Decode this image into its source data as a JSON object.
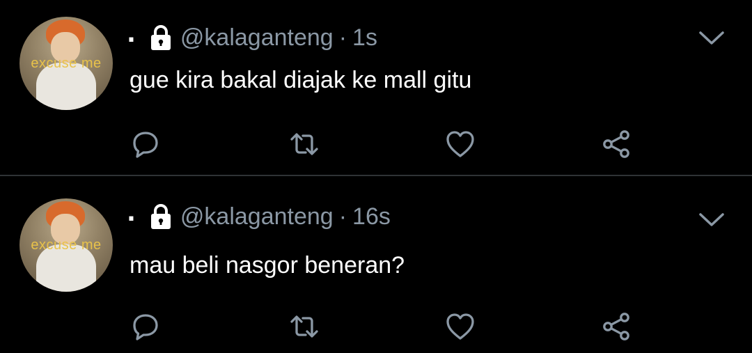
{
  "tweets": [
    {
      "name_label": ".",
      "handle": "@kalaganteng",
      "separator": "·",
      "time": "1s",
      "text": "gue kira bakal diajak ke mall gitu",
      "avatar_caption": "excuse me"
    },
    {
      "name_label": ".",
      "handle": "@kalaganteng",
      "separator": "·",
      "time": "16s",
      "text": "mau beli nasgor beneran?",
      "avatar_caption": "excuse me"
    }
  ],
  "icons": {
    "lock": "lock-icon",
    "chevron": "chevron-down-icon",
    "reply": "reply-icon",
    "retweet": "retweet-icon",
    "like": "heart-icon",
    "share": "share-icon"
  },
  "colors": {
    "background": "#000000",
    "primary_text": "#ffffff",
    "secondary_text": "#8b98a5",
    "divider": "#2f3336"
  }
}
